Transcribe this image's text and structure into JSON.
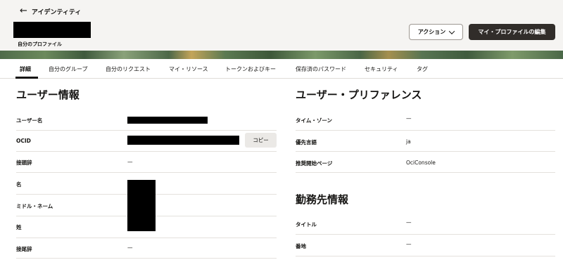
{
  "header": {
    "back_label": "アイデンティティ",
    "subtitle": "自分のプロファイル",
    "action_button": "アクション",
    "edit_button": "マイ・プロファイルの編集"
  },
  "tabs": [
    {
      "label": "詳細",
      "active": true
    },
    {
      "label": "自分のグループ"
    },
    {
      "label": "自分のリクエスト"
    },
    {
      "label": "マイ・リソース"
    },
    {
      "label": "トークンおよびキー"
    },
    {
      "label": "保存済のパスワード"
    },
    {
      "label": "セキュリティ"
    },
    {
      "label": "タグ"
    }
  ],
  "user_info": {
    "title": "ユーザー情報",
    "rows": [
      {
        "label": "ユーザー名",
        "value": ""
      },
      {
        "label": "OCID",
        "value": ""
      },
      {
        "label": "接頭辞",
        "value": "—"
      },
      {
        "label": "名",
        "value": ""
      },
      {
        "label": "ミドル・ネーム",
        "value": ""
      },
      {
        "label": "姓",
        "value": ""
      },
      {
        "label": "接尾辞",
        "value": "—"
      }
    ],
    "copy_button": "コピー"
  },
  "preferences": {
    "title": "ユーザー・プリファレンス",
    "rows": [
      {
        "label": "タイム・ゾーン",
        "value": "—"
      },
      {
        "label": "優先言語",
        "value": "ja"
      },
      {
        "label": "推奨開始ページ",
        "value": "OciConsole"
      }
    ]
  },
  "work_info": {
    "title": "勤務先情報",
    "rows": [
      {
        "label": "タイトル",
        "value": "—"
      },
      {
        "label": "番地",
        "value": "—"
      }
    ]
  },
  "colors": {
    "primary_button": "#312d2a",
    "page_header_bg": "#f5f4f2",
    "divider": "#e4e1dd"
  }
}
